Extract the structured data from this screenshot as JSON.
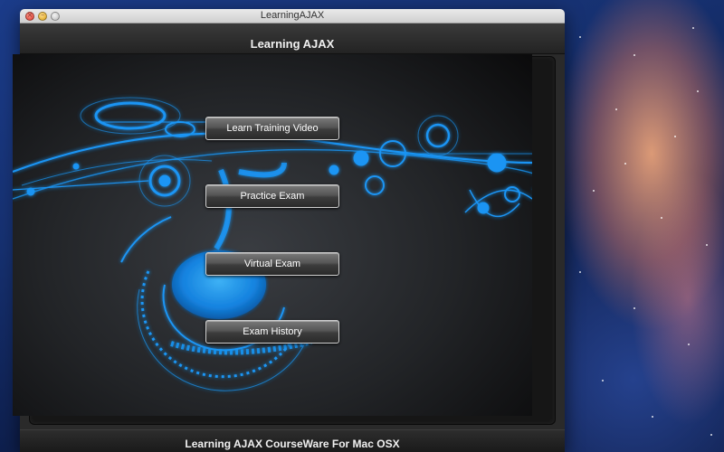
{
  "window": {
    "title": "LearningAJAX"
  },
  "header": {
    "title": "Learning AJAX"
  },
  "menu": {
    "learn_training_video": "Learn Training Video",
    "practice_exam": "Practice Exam",
    "virtual_exam": "Virtual Exam",
    "exam_history": "Exam History"
  },
  "footer": {
    "text": "Learning AJAX CourseWare For Mac OSX"
  },
  "colors": {
    "accent_blue": "#1a9bff",
    "panel_dark": "#222427"
  }
}
